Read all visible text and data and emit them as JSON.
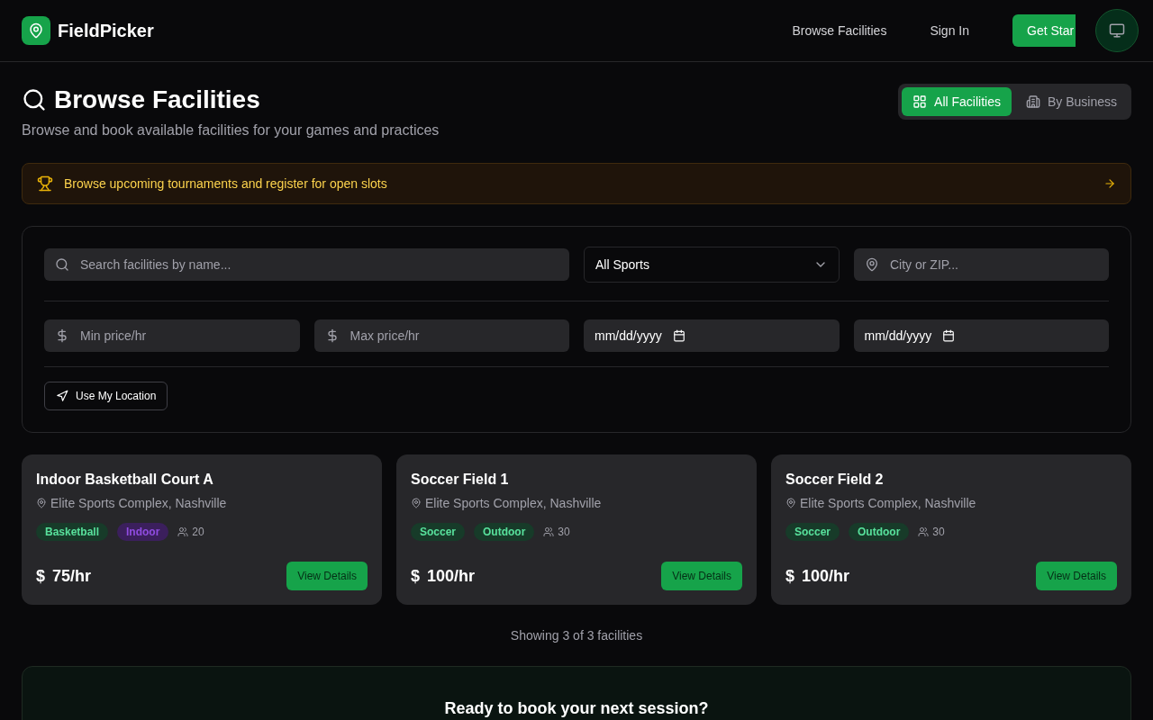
{
  "header": {
    "brand": "FieldPicker",
    "nav": [
      {
        "label": "Browse Facilities"
      },
      {
        "label": "Sign In"
      }
    ],
    "cta": "Get Star"
  },
  "page": {
    "title": "Browse Facilities",
    "subtitle": "Browse and book available facilities for your games and practices",
    "views": [
      {
        "label": "All Facilities",
        "selected": true
      },
      {
        "label": "By Business",
        "selected": false
      }
    ]
  },
  "banner": {
    "text": "Browse upcoming tournaments and register for open slots"
  },
  "filters": {
    "search": {
      "placeholder": "Search facilities by name..."
    },
    "sport": {
      "value": "All Sports"
    },
    "location": {
      "placeholder": "City or ZIP..."
    },
    "min_price": {
      "placeholder": "Min price/hr"
    },
    "max_price": {
      "placeholder": "Max price/hr"
    },
    "dates": [
      {
        "value": "mm/dd/yyyy"
      },
      {
        "value": "mm/dd/yyyy"
      }
    ],
    "use_location": "Use My Location"
  },
  "facilities": [
    {
      "name": "Indoor Basketball Court A",
      "place": "Elite Sports Complex, Nashville",
      "tags": [
        {
          "label": "Basketball",
          "color": "#173b29"
        },
        {
          "label": "Indoor",
          "color": "#3b1f5c"
        }
      ],
      "capacity": "20",
      "currency": "$",
      "price": "75/hr",
      "action": "View Details"
    },
    {
      "name": "Soccer Field 1",
      "place": "Elite Sports Complex, Nashville",
      "tags": [
        {
          "label": "Soccer",
          "color": "#173b29"
        },
        {
          "label": "Outdoor",
          "color": "#173b29"
        }
      ],
      "capacity": "30",
      "currency": "$",
      "price": "100/hr",
      "action": "View Details"
    },
    {
      "name": "Soccer Field 2",
      "place": "Elite Sports Complex, Nashville",
      "tags": [
        {
          "label": "Soccer",
          "color": "#173b29"
        },
        {
          "label": "Outdoor",
          "color": "#173b29"
        }
      ],
      "capacity": "30",
      "currency": "$",
      "price": "100/hr",
      "action": "View Details"
    }
  ],
  "results_count": "Showing 3 of 3 facilities",
  "cta_section": {
    "title": "Ready to book your next session?"
  }
}
